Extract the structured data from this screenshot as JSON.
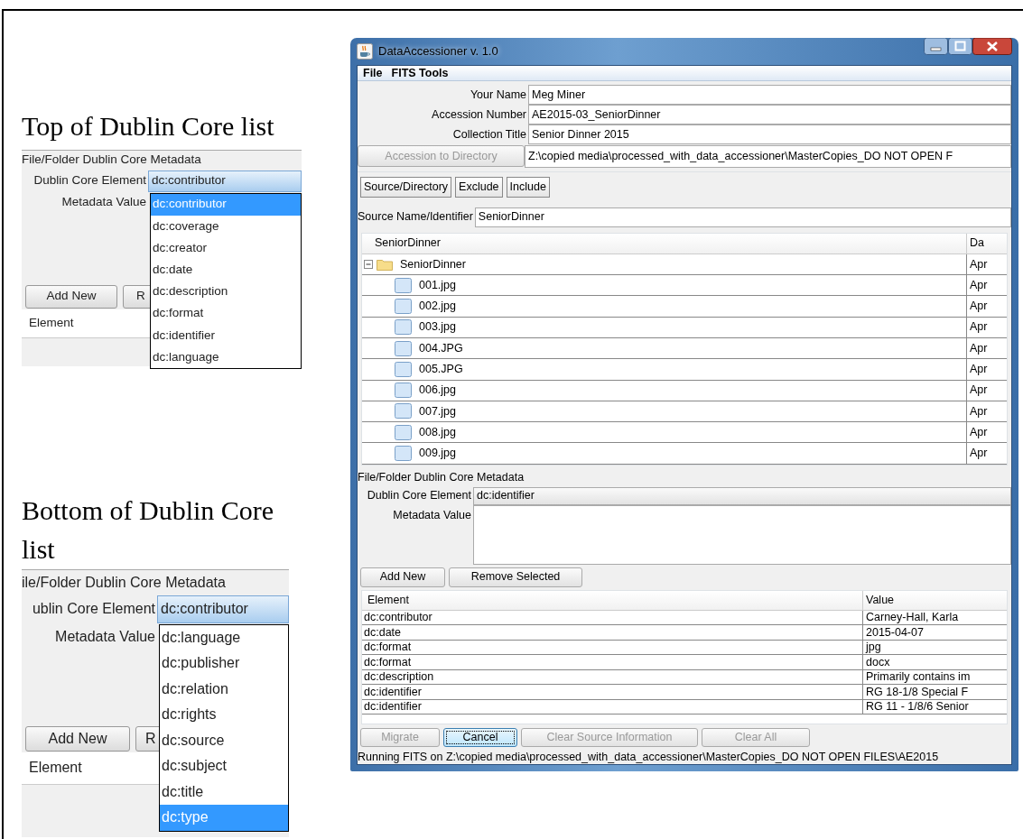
{
  "panels": [
    {
      "caption": "Top of Dublin Core list",
      "section_title": "File/Folder Dublin Core Metadata",
      "element_label": "Dublin Core Element",
      "element_value": "dc:contributor",
      "value_label": "Metadata Value",
      "buttons": [
        "Add New",
        "R"
      ],
      "table_header": "Element",
      "options": [
        {
          "label": "dc:contributor",
          "selected": true
        },
        {
          "label": "dc:coverage",
          "selected": false
        },
        {
          "label": "dc:creator",
          "selected": false
        },
        {
          "label": "dc:date",
          "selected": false
        },
        {
          "label": "dc:description",
          "selected": false
        },
        {
          "label": "dc:format",
          "selected": false
        },
        {
          "label": "dc:identifier",
          "selected": false
        },
        {
          "label": "dc:language",
          "selected": false
        }
      ]
    },
    {
      "caption": "Bottom of Dublin Core list",
      "section_title": "ile/Folder Dublin Core Metadata",
      "element_label": "ublin Core Element",
      "element_value": "dc:contributor",
      "value_label": "Metadata Value",
      "buttons": [
        "Add New",
        "R"
      ],
      "table_header": "Element",
      "options": [
        {
          "label": "dc:language",
          "selected": false
        },
        {
          "label": "dc:publisher",
          "selected": false
        },
        {
          "label": "dc:relation",
          "selected": false
        },
        {
          "label": "dc:rights",
          "selected": false
        },
        {
          "label": "dc:source",
          "selected": false
        },
        {
          "label": "dc:subject",
          "selected": false
        },
        {
          "label": "dc:title",
          "selected": false
        },
        {
          "label": "dc:type",
          "selected": true
        }
      ]
    }
  ],
  "window": {
    "title": "DataAccessioner v. 1.0",
    "menu": [
      "File",
      "FITS Tools"
    ],
    "fields": [
      {
        "label": "Your Name",
        "value": "Meg Miner"
      },
      {
        "label": "Accession Number",
        "value": "AE2015-03_SeniorDinner"
      },
      {
        "label": "Collection Title",
        "value": "Senior Dinner 2015"
      }
    ],
    "directory_button": {
      "label": "Accession to Directory",
      "disabled": true
    },
    "directory_path": "Z:\\copied media\\processed_with_data_accessioner\\MasterCopies_DO NOT OPEN F",
    "source_buttons": [
      "Source/Directory",
      "Exclude",
      "Include"
    ],
    "source_name": {
      "label": "Source Name/Identifier",
      "value": "SeniorDinner"
    },
    "tree": {
      "columns": [
        "SeniorDinner",
        "Da"
      ],
      "root": {
        "name": "SeniorDinner",
        "expanded": true,
        "date": "Apr",
        "children": [
          {
            "name": "001.jpg",
            "date": "Apr"
          },
          {
            "name": "002.jpg",
            "date": "Apr"
          },
          {
            "name": "003.jpg",
            "date": "Apr"
          },
          {
            "name": "004.JPG",
            "date": "Apr"
          },
          {
            "name": "005.JPG",
            "date": "Apr"
          },
          {
            "name": "006.jpg",
            "date": "Apr"
          },
          {
            "name": "007.jpg",
            "date": "Apr"
          },
          {
            "name": "008.jpg",
            "date": "Apr"
          },
          {
            "name": "009.jpg",
            "date": "Apr"
          }
        ]
      }
    },
    "metadata": {
      "title": "File/Folder Dublin Core Metadata",
      "element_label": "Dublin Core Element",
      "element_value": "dc:identifier",
      "value_label": "Metadata Value",
      "buttons": [
        "Add New",
        "Remove Selected"
      ],
      "columns": [
        "Element",
        "Value"
      ],
      "rows": [
        [
          "dc:contributor",
          "Carney-Hall, Karla"
        ],
        [
          "dc:date",
          "2015-04-07"
        ],
        [
          "dc:format",
          "jpg"
        ],
        [
          "dc:format",
          "docx"
        ],
        [
          "dc:description",
          "Primarily contains im"
        ],
        [
          "dc:identifier",
          "RG 18-1/8 Special F"
        ],
        [
          "dc:identifier",
          "RG 11 - 1/8/6 Senior"
        ]
      ]
    },
    "actions": [
      {
        "label": "Migrate",
        "disabled": true,
        "focused": false
      },
      {
        "label": "Cancel",
        "disabled": false,
        "focused": true
      },
      {
        "label": "Clear Source Information",
        "disabled": true,
        "focused": false
      },
      {
        "label": "Clear All",
        "disabled": true,
        "focused": false
      }
    ],
    "status": "Running FITS on Z:\\copied media\\processed_with_data_accessioner\\MasterCopies_DO NOT OPEN FILES\\AE2015"
  }
}
